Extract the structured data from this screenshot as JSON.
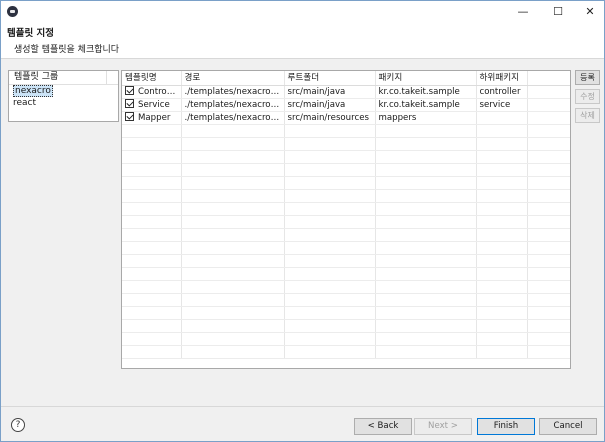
{
  "window": {
    "controls": {
      "minimize": "—",
      "maximize": "☐",
      "close": "✕"
    }
  },
  "header": {
    "title": "템플릿 지정",
    "subtitle": "생성할 템플릿을 체크합니다"
  },
  "template_groups": {
    "column_header": "템플릿 그룹",
    "items": [
      {
        "label": "nexacro",
        "selected": true
      },
      {
        "label": "react",
        "selected": false
      }
    ]
  },
  "templates": {
    "columns": [
      "템플릿명",
      "경로",
      "루트폴더",
      "패키지",
      "하위패키지"
    ],
    "rows": [
      {
        "checked": true,
        "name": "Controller",
        "path": "./templates/nexacro/cont...",
        "root": "src/main/java",
        "package": "kr.co.takeit.sample",
        "subpackage": "controller"
      },
      {
        "checked": true,
        "name": "Service",
        "path": "./templates/nexacro/servi...",
        "root": "src/main/java",
        "package": "kr.co.takeit.sample",
        "subpackage": "service"
      },
      {
        "checked": true,
        "name": "Mapper",
        "path": "./templates/nexacro/map...",
        "root": "src/main/resources",
        "package": "mappers",
        "subpackage": ""
      }
    ]
  },
  "side_buttons": {
    "add": "등록",
    "edit": "수정",
    "delete": "삭제"
  },
  "footer": {
    "help_icon": "?",
    "back": "< Back",
    "next": "Next >",
    "finish": "Finish",
    "cancel": "Cancel"
  }
}
